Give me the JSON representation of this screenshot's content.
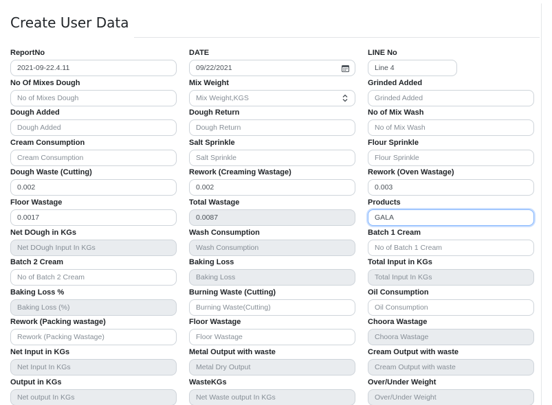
{
  "page": {
    "title": "Create User Data"
  },
  "fields": [
    {
      "label": "ReportNo",
      "value": "2021-09-22.4.11",
      "placeholder": ""
    },
    {
      "label": "DATE",
      "value": "09/22/2021",
      "placeholder": "",
      "icon": "calendar-icon"
    },
    {
      "label": "LINE No",
      "value": "Line 4",
      "placeholder": ""
    },
    {
      "label": "No Of Mixes Dough",
      "value": "",
      "placeholder": "No of Mixes Dough"
    },
    {
      "label": "Mix Weight",
      "value": "",
      "placeholder": "Mix Weight,KGS",
      "icon": "spinner-icon"
    },
    {
      "label": "Grinded Added",
      "value": "",
      "placeholder": "Grinded Added"
    },
    {
      "label": "Dough Added",
      "value": "",
      "placeholder": "Dough Added"
    },
    {
      "label": "Dough Return",
      "value": "",
      "placeholder": "Dough Return"
    },
    {
      "label": "No of Mix Wash",
      "value": "",
      "placeholder": "No of Mix Wash"
    },
    {
      "label": "Cream Consumption",
      "value": "",
      "placeholder": "Cream Consumption"
    },
    {
      "label": "Salt Sprinkle",
      "value": "",
      "placeholder": "Salt Sprinkle"
    },
    {
      "label": "Flour Sprinkle",
      "value": "",
      "placeholder": "Flour Sprinkle"
    },
    {
      "label": "Dough Waste (Cutting)",
      "value": "0.002",
      "placeholder": ""
    },
    {
      "label": "Rework (Creaming Wastage)",
      "value": "0.002",
      "placeholder": ""
    },
    {
      "label": "Rework (Oven Wastage)",
      "value": "0.003",
      "placeholder": ""
    },
    {
      "label": "Floor Wastage",
      "value": "0.0017",
      "placeholder": ""
    },
    {
      "label": "Total Wastage",
      "value": "0.0087",
      "placeholder": ""
    },
    {
      "label": "Products",
      "value": "GALA",
      "placeholder": ""
    },
    {
      "label": "Net DOugh in KGs",
      "value": "",
      "placeholder": "Net DOugh Input In KGs"
    },
    {
      "label": "Wash Consumption",
      "value": "",
      "placeholder": "Wash Consumption"
    },
    {
      "label": "Batch 1 Cream",
      "value": "",
      "placeholder": "No of Batch 1 Cream"
    },
    {
      "label": "Batch 2 Cream",
      "value": "",
      "placeholder": "No of Batch 2 Cream"
    },
    {
      "label": "Baking Loss",
      "value": "",
      "placeholder": "Baking Loss"
    },
    {
      "label": "Total Input in KGs",
      "value": "",
      "placeholder": "Total Input In KGs"
    },
    {
      "label": "Baking Loss %",
      "value": "",
      "placeholder": "Baking Loss (%)"
    },
    {
      "label": "Burning Waste (Cutting)",
      "value": "",
      "placeholder": "Burning Waste(Cutting)"
    },
    {
      "label": "Oil Consumption",
      "value": "",
      "placeholder": "Oil Consumption"
    },
    {
      "label": "Rework (Packing wastage)",
      "value": "",
      "placeholder": "Rework (Packing Wastage)"
    },
    {
      "label": "Floor Wastage",
      "value": "",
      "placeholder": "Floor Wastage"
    },
    {
      "label": "Choora Wastage",
      "value": "",
      "placeholder": "Choora Wastage"
    },
    {
      "label": "Net Input in KGs",
      "value": "",
      "placeholder": "Net Input In KGs"
    },
    {
      "label": "Metal Output with waste",
      "value": "",
      "placeholder": "Metal Dry Output"
    },
    {
      "label": "Cream Output with waste",
      "value": "",
      "placeholder": "Cream Output with waste"
    },
    {
      "label": "Output in KGs",
      "value": "",
      "placeholder": "Net output In KGs"
    },
    {
      "label": "WasteKGs",
      "value": "",
      "placeholder": "Net Waste output In KGs"
    },
    {
      "label": "Over/Under Weight",
      "value": "",
      "placeholder": "Over/Under Weight"
    }
  ],
  "colors": {
    "disabled_bg": "#e9ecef",
    "focus_border": "#86b7fe",
    "border": "#ced4da"
  }
}
